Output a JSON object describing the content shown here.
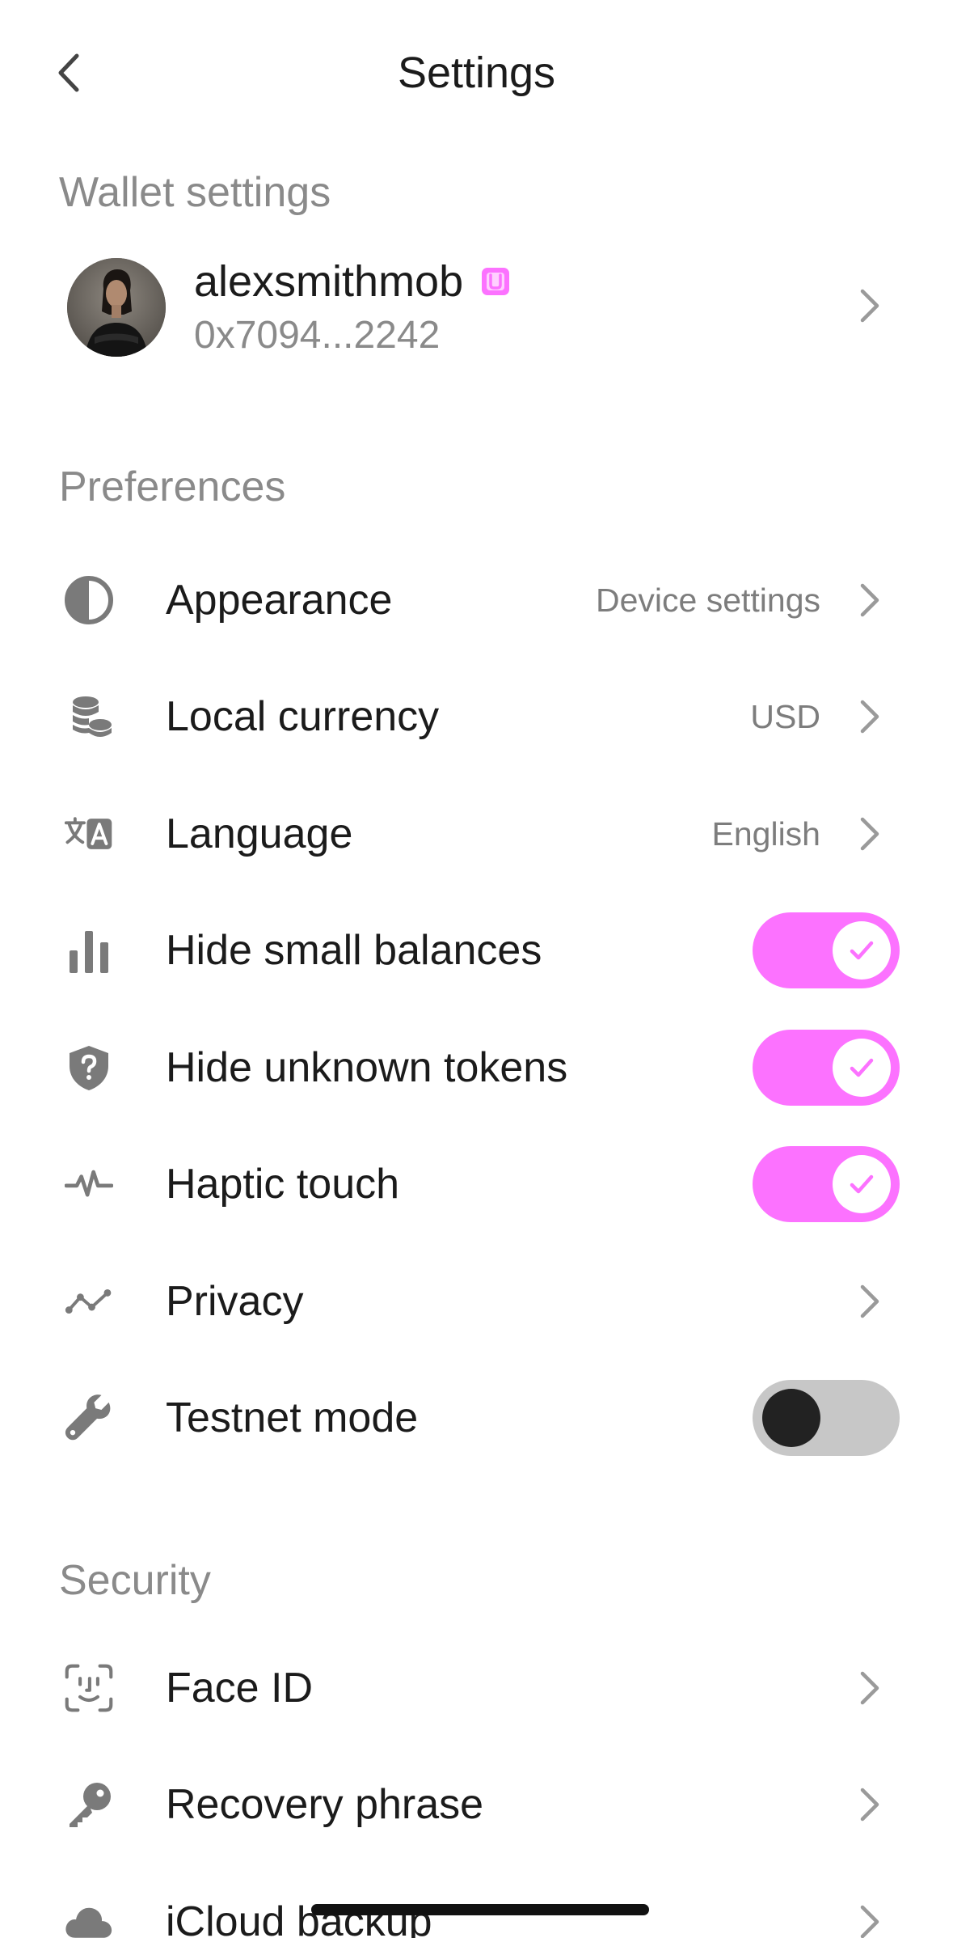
{
  "header": {
    "title": "Settings"
  },
  "sections": {
    "wallet": "Wallet settings",
    "preferences": "Preferences",
    "security": "Security"
  },
  "wallet": {
    "username": "alexsmithmob",
    "address": "0x7094...2242"
  },
  "preferences": {
    "appearance": {
      "label": "Appearance",
      "value": "Device settings",
      "icon": "contrast-icon"
    },
    "currency": {
      "label": "Local currency",
      "value": "USD",
      "icon": "coins-icon"
    },
    "language": {
      "label": "Language",
      "value": "English",
      "icon": "translate-icon"
    },
    "hide_small_balances": {
      "label": "Hide small balances",
      "enabled": true,
      "icon": "bar-chart-icon"
    },
    "hide_unknown_tokens": {
      "label": "Hide unknown tokens",
      "enabled": true,
      "icon": "shield-question-icon"
    },
    "haptic_touch": {
      "label": "Haptic touch",
      "enabled": true,
      "icon": "pulse-icon"
    },
    "privacy": {
      "label": "Privacy",
      "icon": "line-graph-icon"
    },
    "testnet_mode": {
      "label": "Testnet mode",
      "enabled": false,
      "icon": "wrench-icon"
    }
  },
  "security": {
    "face_id": {
      "label": "Face ID",
      "icon": "face-id-icon"
    },
    "recovery_phrase": {
      "label": "Recovery phrase",
      "icon": "key-icon"
    },
    "icloud_backup": {
      "label": "iCloud backup",
      "icon": "cloud-icon"
    }
  },
  "colors": {
    "accent": "#fc72ff",
    "toggle_off": "#c7c7c7",
    "secondary_text": "#8a8a8a",
    "icon_gray": "#7a7a7a"
  }
}
